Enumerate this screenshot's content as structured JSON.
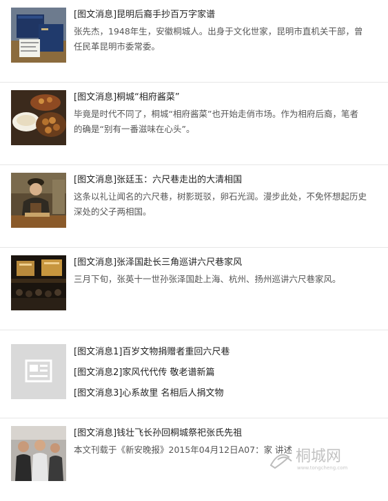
{
  "items": [
    {
      "title": "[图文消息]昆明后裔手抄百万字家谱",
      "desc": "张先杰，1948年生，安徽桐城人。出身于文化世家，昆明市直机关干部，曾任民革昆明市委常委。",
      "thumb_icon": "boxes-photo"
    },
    {
      "title": "[图文消息]桐城“相府酱菜”",
      "desc": "毕竟是时代不同了，桐城“相府酱菜”也开始走俏市场。作为相府后裔，笔者的确是“别有一番滋味在心头”。",
      "thumb_icon": "food-photo"
    },
    {
      "title": "[图文消息]张廷玉：六尺巷走出的大清相国",
      "desc": "这条以礼让闻名的六尺巷，树影斑驳，卵石光润。漫步此处，不免怀想起历史深处的父子两相国。",
      "thumb_icon": "qing-official-photo"
    },
    {
      "title": "[图文消息]张泽国赴长三角巡讲六尺巷家风",
      "desc": "三月下旬，张英十一世孙张泽国赴上海、杭州、扬州巡讲六尺巷家风。",
      "thumb_icon": "lecture-hall-photo"
    },
    {
      "titles": [
        "[图文消息1]百岁文物捐赠者重回六尺巷",
        "[图文消息2]家风代代传 敬老谱新篇",
        "[图文消息3]心系故里 名相后人捐文物"
      ],
      "thumb_icon": "news-placeholder-icon"
    },
    {
      "title": "[图文消息]钱壮飞长孙回桐城祭祀张氏先祖",
      "desc": "本文刊载于《新安晚报》2015年04月12日A07：家  讲述",
      "thumb_icon": "group-photo"
    }
  ],
  "watermark": {
    "text": "桐城网",
    "url": "www.tongcheng.com"
  },
  "colors": {
    "divider": "#e6e6e6",
    "title": "#222222",
    "desc": "#555555",
    "placeholder_bg": "#d9d9d9"
  }
}
